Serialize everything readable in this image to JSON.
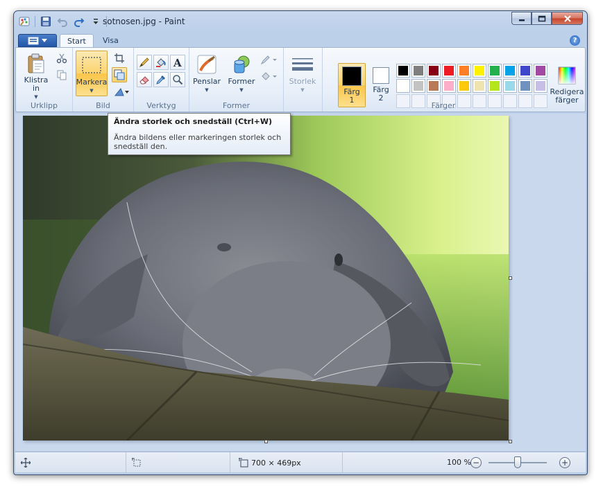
{
  "window": {
    "title": "sotnosen.jpg - Paint"
  },
  "tabs": {
    "menu": "menu-button",
    "start": "Start",
    "view": "Visa"
  },
  "ribbon": {
    "clipboard": {
      "label": "Urklipp",
      "paste": "Klistra in"
    },
    "image": {
      "label": "Bild",
      "select": "Markera"
    },
    "tools": {
      "label": "Verktyg"
    },
    "shapes": {
      "label": "Former",
      "brushes": "Penslar",
      "shapes_btn": "Former"
    },
    "size": {
      "label": "Storlek"
    },
    "colors": {
      "label": "Färger",
      "color1": "Färg 1",
      "color2": "Färg 2",
      "edit": "Redigera färger",
      "color1_value": "#000000",
      "color2_value": "#ffffff",
      "palette": [
        "#000000",
        "#7f7f7f",
        "#880015",
        "#ed1c24",
        "#ff7f27",
        "#fff200",
        "#22b14c",
        "#00a2e8",
        "#3f48cc",
        "#a349a4",
        "#ffffff",
        "#c3c3c3",
        "#b97a57",
        "#ffaec9",
        "#ffc90e",
        "#efe4b0",
        "#b5e61d",
        "#99d9ea",
        "#7092be",
        "#c8bfe7",
        "",
        "",
        "",
        "",
        "",
        "",
        "",
        "",
        "",
        ""
      ]
    }
  },
  "tooltip": {
    "title": "Ändra storlek och snedställ (Ctrl+W)",
    "description": "Ändra bildens eller markeringen storlek och snedställ den."
  },
  "status": {
    "image_size": "700 × 469px",
    "zoom": "100 %",
    "zoom_fraction": 0.5
  }
}
